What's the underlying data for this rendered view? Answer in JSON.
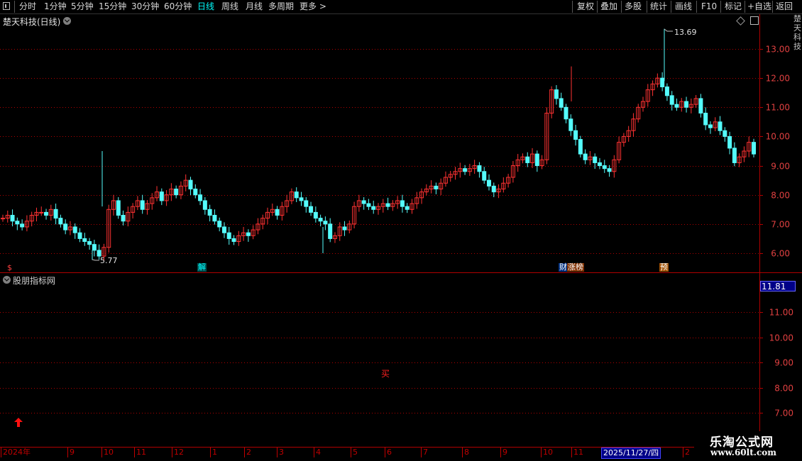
{
  "toolbar": {
    "periods": [
      "分时",
      "1分钟",
      "5分钟",
      "15分钟",
      "30分钟",
      "60分钟",
      "日线",
      "周线",
      "月线",
      "多周期",
      "更多"
    ],
    "active_period": "日线",
    "more_arrow": ">",
    "right_buttons": [
      "复权",
      "叠加",
      "多股",
      "统计",
      "画线",
      "F10",
      "标记",
      "+自选",
      "返回"
    ]
  },
  "main_chart": {
    "title": "楚天科技(日线)",
    "high_label": "13.69",
    "low_label": "5.77",
    "y_ticks": [
      "13.00",
      "12.00",
      "11.00",
      "10.00",
      "9.00",
      "8.00",
      "7.00",
      "6.00"
    ],
    "markers": [
      {
        "text": "$",
        "color": "#ff4040",
        "bg": "#000000"
      },
      {
        "text": "解",
        "color": "#00ffff",
        "bg": "#005050"
      },
      {
        "text": "财",
        "color": "#ffffff",
        "bg": "#003080"
      },
      {
        "text": "涨榜",
        "color": "#ffffff",
        "bg": "#803000"
      },
      {
        "text": "预",
        "color": "#ffffff",
        "bg": "#a05000"
      }
    ],
    "right_strip_text": "楚天科技"
  },
  "indicator_panel": {
    "title": "股朋指标网",
    "current_value": "11.81",
    "y_ticks": [
      "11.00",
      "10.00",
      "9.00",
      "8.00",
      "7.00"
    ],
    "signal_text": "买"
  },
  "date_axis": {
    "labels": [
      "2024年",
      "9",
      "10",
      "11",
      "12",
      "1",
      "2",
      "3",
      "4",
      "5",
      "6",
      "7",
      "8",
      "9",
      "10",
      "11",
      "2"
    ],
    "cursor_date": "2025/11/27/四"
  },
  "watermark": {
    "title": "乐淘公式网",
    "url": "www.60lt.com"
  },
  "colors": {
    "up": "#ff3232",
    "down": "#54fcfc",
    "grid": "#b00000",
    "axis_text": "#e04040"
  },
  "chart_data": {
    "type": "candlestick",
    "closes": [
      7.2,
      7.3,
      7.1,
      7.0,
      6.9,
      7.1,
      7.3,
      7.4,
      7.4,
      7.3,
      7.5,
      7.2,
      7.0,
      6.8,
      6.9,
      6.7,
      6.5,
      6.4,
      6.3,
      6.1,
      5.9,
      6.2,
      7.5,
      7.8,
      7.3,
      7.1,
      7.4,
      7.6,
      7.8,
      7.5,
      7.7,
      7.9,
      8.1,
      7.8,
      8.0,
      8.2,
      8.0,
      8.3,
      8.5,
      8.2,
      8.0,
      7.8,
      7.5,
      7.3,
      7.1,
      6.9,
      6.7,
      6.5,
      6.4,
      6.6,
      6.7,
      6.6,
      6.8,
      7.0,
      7.2,
      7.4,
      7.5,
      7.3,
      7.6,
      7.8,
      8.1,
      7.9,
      7.8,
      7.6,
      7.4,
      7.2,
      7.1,
      7.0,
      6.5,
      6.6,
      6.9,
      6.8,
      7.0,
      7.6,
      7.8,
      7.7,
      7.6,
      7.5,
      7.6,
      7.7,
      7.6,
      7.7,
      7.8,
      7.6,
      7.5,
      7.7,
      7.9,
      8.1,
      8.2,
      8.3,
      8.2,
      8.4,
      8.6,
      8.7,
      8.8,
      8.9,
      8.8,
      8.9,
      9.0,
      8.8,
      8.5,
      8.3,
      8.1,
      8.2,
      8.4,
      8.6,
      9.0,
      9.2,
      9.3,
      9.1,
      9.4,
      9.0,
      9.2,
      10.8,
      11.6,
      11.3,
      11.0,
      10.6,
      10.2,
      9.9,
      9.4,
      9.2,
      9.3,
      9.1,
      9.0,
      8.9,
      8.8,
      9.2,
      9.8,
      10.0,
      10.2,
      10.6,
      11.0,
      11.2,
      11.6,
      11.8,
      12.0,
      11.7,
      11.4,
      11.1,
      11.0,
      11.2,
      11.0,
      11.1,
      11.3,
      10.8,
      10.4,
      10.3,
      10.5,
      10.2,
      10.0,
      9.6,
      9.1,
      9.3,
      9.5,
      9.8,
      9.4
    ]
  }
}
